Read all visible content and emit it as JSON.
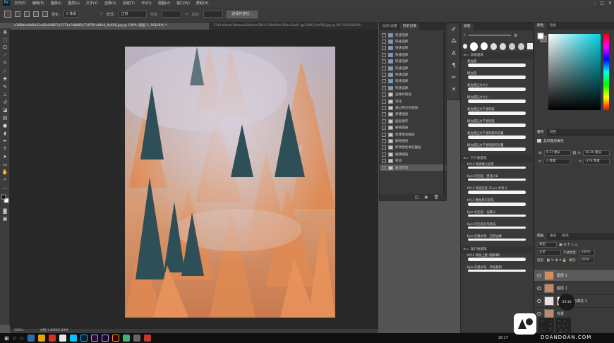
{
  "menubar": {
    "app_icon": "Ps",
    "items": [
      "文件(F)",
      "编辑(E)",
      "图像(I)",
      "图层(L)",
      "文字(Y)",
      "选择(S)",
      "滤镜(T)",
      "3D(D)",
      "视图(V)",
      "窗口(W)",
      "帮助(H)"
    ]
  },
  "options": {
    "feather_label": "羽化:",
    "feather_value": "0 像素",
    "style_label": "样式:",
    "style_value": "正常",
    "width_label": "宽度:",
    "height_label": "高度:",
    "select_mask_btn": "选择并遮住..."
  },
  "tabs": [
    {
      "label": "e168ddd4d0a52c42e04817a3773a7d8b85c71076f-nBfu0_fw658.jpg @ 100% (图层 2, RGB/8#) *",
      "active": true
    },
    {
      "label": "3741cf4eeb14ebaed29d4ad7814278a49ba154ca2e41-gs1OBO_fw658.jpg @ 66.7%(RGB/8#)",
      "active": false
    }
  ],
  "status": {
    "zoom": "100%",
    "doc": "文档:1.60M/5.89M"
  },
  "history": {
    "tabs": [
      "动作/设置",
      "历史记录"
    ],
    "rows": [
      {
        "label": "快速选择",
        "icon": "selection-icon"
      },
      {
        "label": "快速选择",
        "icon": "selection-icon"
      },
      {
        "label": "快速选择",
        "icon": "selection-icon"
      },
      {
        "label": "快速选择",
        "icon": "selection-icon"
      },
      {
        "label": "快速选择",
        "icon": "selection-icon"
      },
      {
        "label": "快速选择",
        "icon": "selection-icon"
      },
      {
        "label": "快速选择",
        "icon": "selection-icon"
      },
      {
        "label": "快速选择",
        "icon": "selection-icon"
      },
      {
        "label": "快速选择",
        "icon": "selection-icon"
      },
      {
        "label": "选择并遮住",
        "icon": "doc-icon"
      },
      {
        "label": "羽化",
        "icon": "doc-icon"
      },
      {
        "label": "通过拷贝的图层",
        "icon": "doc-icon"
      },
      {
        "label": "新建图层",
        "icon": "doc-icon"
      },
      {
        "label": "图层顺序",
        "icon": "doc-icon"
      },
      {
        "label": "删除图层",
        "icon": "doc-icon"
      },
      {
        "label": "新建填充图层",
        "icon": "doc-icon"
      },
      {
        "label": "删除图层",
        "icon": "doc-icon"
      },
      {
        "label": "修改颜色填充图层",
        "icon": "doc-icon"
      },
      {
        "label": "编辑图层",
        "icon": "doc-icon"
      },
      {
        "label": "移动",
        "icon": "doc-icon"
      },
      {
        "label": "盖印可见",
        "icon": "doc-icon"
      }
    ],
    "selected_index": 20
  },
  "brushes": {
    "tab": "画笔",
    "size_value": "0",
    "groups": [
      {
        "name": "常规画笔",
        "rows": [
          "柔边圆",
          "硬边圆",
          "柔边圆压力大小",
          "硬边圆压力大小",
          "柔边圆压力不透明度",
          "硬边圆压力不透明度",
          "柔边圆压力不透明度和流量",
          "硬边圆压力不透明度和流量"
        ]
      },
      {
        "name": "干介质画笔",
        "rows": [
          "KYLE 终极硬心铅笔",
          "Kyle 的铅笔 - 普通 HB",
          "KYLE 终极炭笔 25 px 中等 2",
          "KYLE 颗粒厚实炭笔",
          "Kyle 的铅笔 - 描摹小",
          "Kyle 的铅笔炭笔素描",
          "Kyle 的墨水笔 - 自然边缘"
        ]
      },
      {
        "name": "湿介质画笔",
        "rows": [
          "KYLE 终极上墨 (粗和细)",
          "Kyle 的墨水笔 - 传统墨刷"
        ]
      }
    ]
  },
  "color_panel": {
    "tabs": [
      "颜色",
      "色板"
    ],
    "accent": "#00d3e6"
  },
  "properties": {
    "tabs": [
      "属性",
      "调整"
    ],
    "title": "盖印图层属性",
    "w_label": "W:",
    "w_value": "9.17 厘米",
    "h_label": "H:",
    "h_value": "16.26 厘米",
    "x_label": "X:",
    "x_value": "-2 像素",
    "y_label": "Y:",
    "y_value": "-279 像素"
  },
  "layers": {
    "tabs": [
      "图层",
      "通道",
      "路径"
    ],
    "kind_label": "类型",
    "blend_mode": "正常",
    "opacity_label": "不透明度:",
    "opacity_value": "100%",
    "lock_label": "锁定:",
    "fill_label": "填充:",
    "fill_value": "100%",
    "rows": [
      {
        "name": "图层 2",
        "selected": true
      },
      {
        "name": "图层 1",
        "selected": false
      },
      {
        "name": "颜色填充 1",
        "selected": false
      },
      {
        "name": "背景",
        "selected": false
      }
    ],
    "timer": "03:10"
  },
  "taskbar": {
    "time": "18:17"
  },
  "watermark": {
    "big": " 图网",
    "small": "DOANDOAN.COM"
  }
}
